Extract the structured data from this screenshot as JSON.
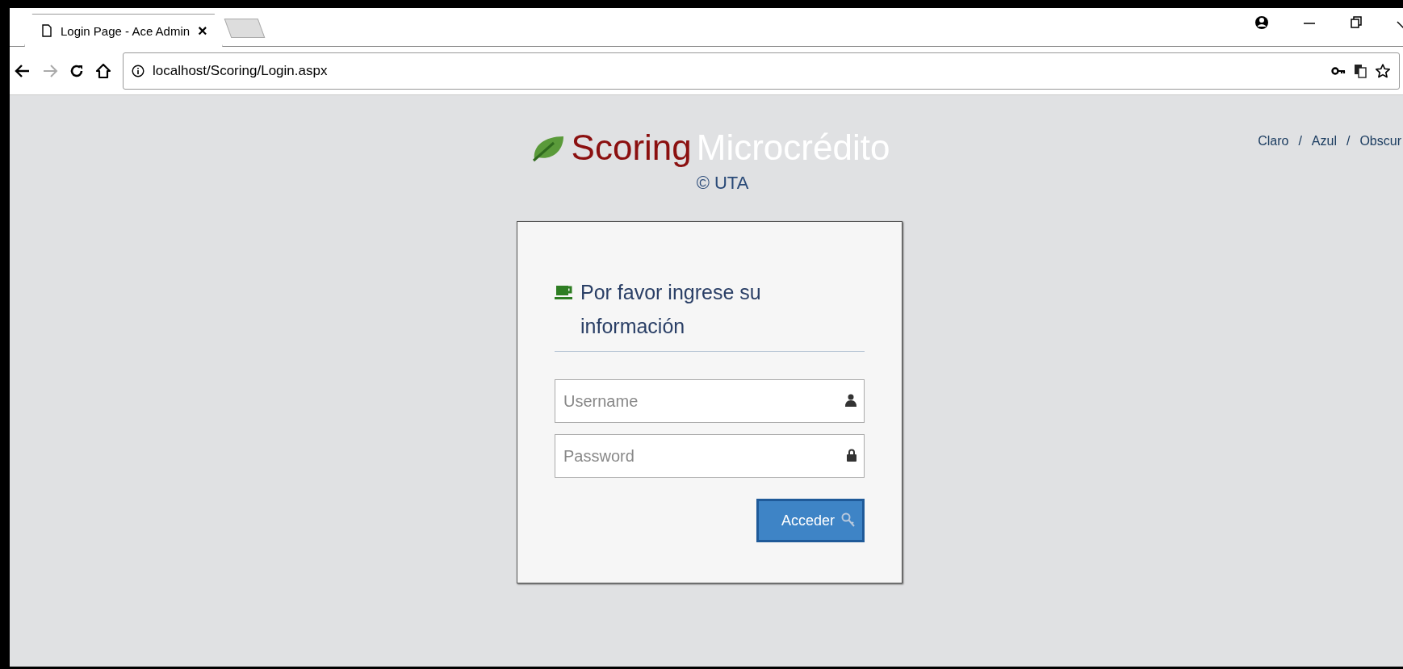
{
  "browser": {
    "tabs": [
      {
        "title": "Login Page - Ace Admin",
        "close": "×",
        "selected": true
      }
    ],
    "address": "localhost/Scoring/Login.aspx"
  },
  "brand": {
    "name": "Scoring",
    "subtitle": "Microcrédito",
    "copyright": "© UTA"
  },
  "themes": [
    {
      "label": "Claro"
    },
    {
      "label": "Azul"
    },
    {
      "label": "Obscur"
    }
  ],
  "theme_separators": [
    "/",
    "/"
  ],
  "login": {
    "heading": "Por favor ingrese su información",
    "fields": [
      {
        "kind": "user",
        "placeholder": "Username"
      },
      {
        "kind": "password",
        "placeholder": "Password"
      }
    ],
    "button": "Acceder"
  }
}
